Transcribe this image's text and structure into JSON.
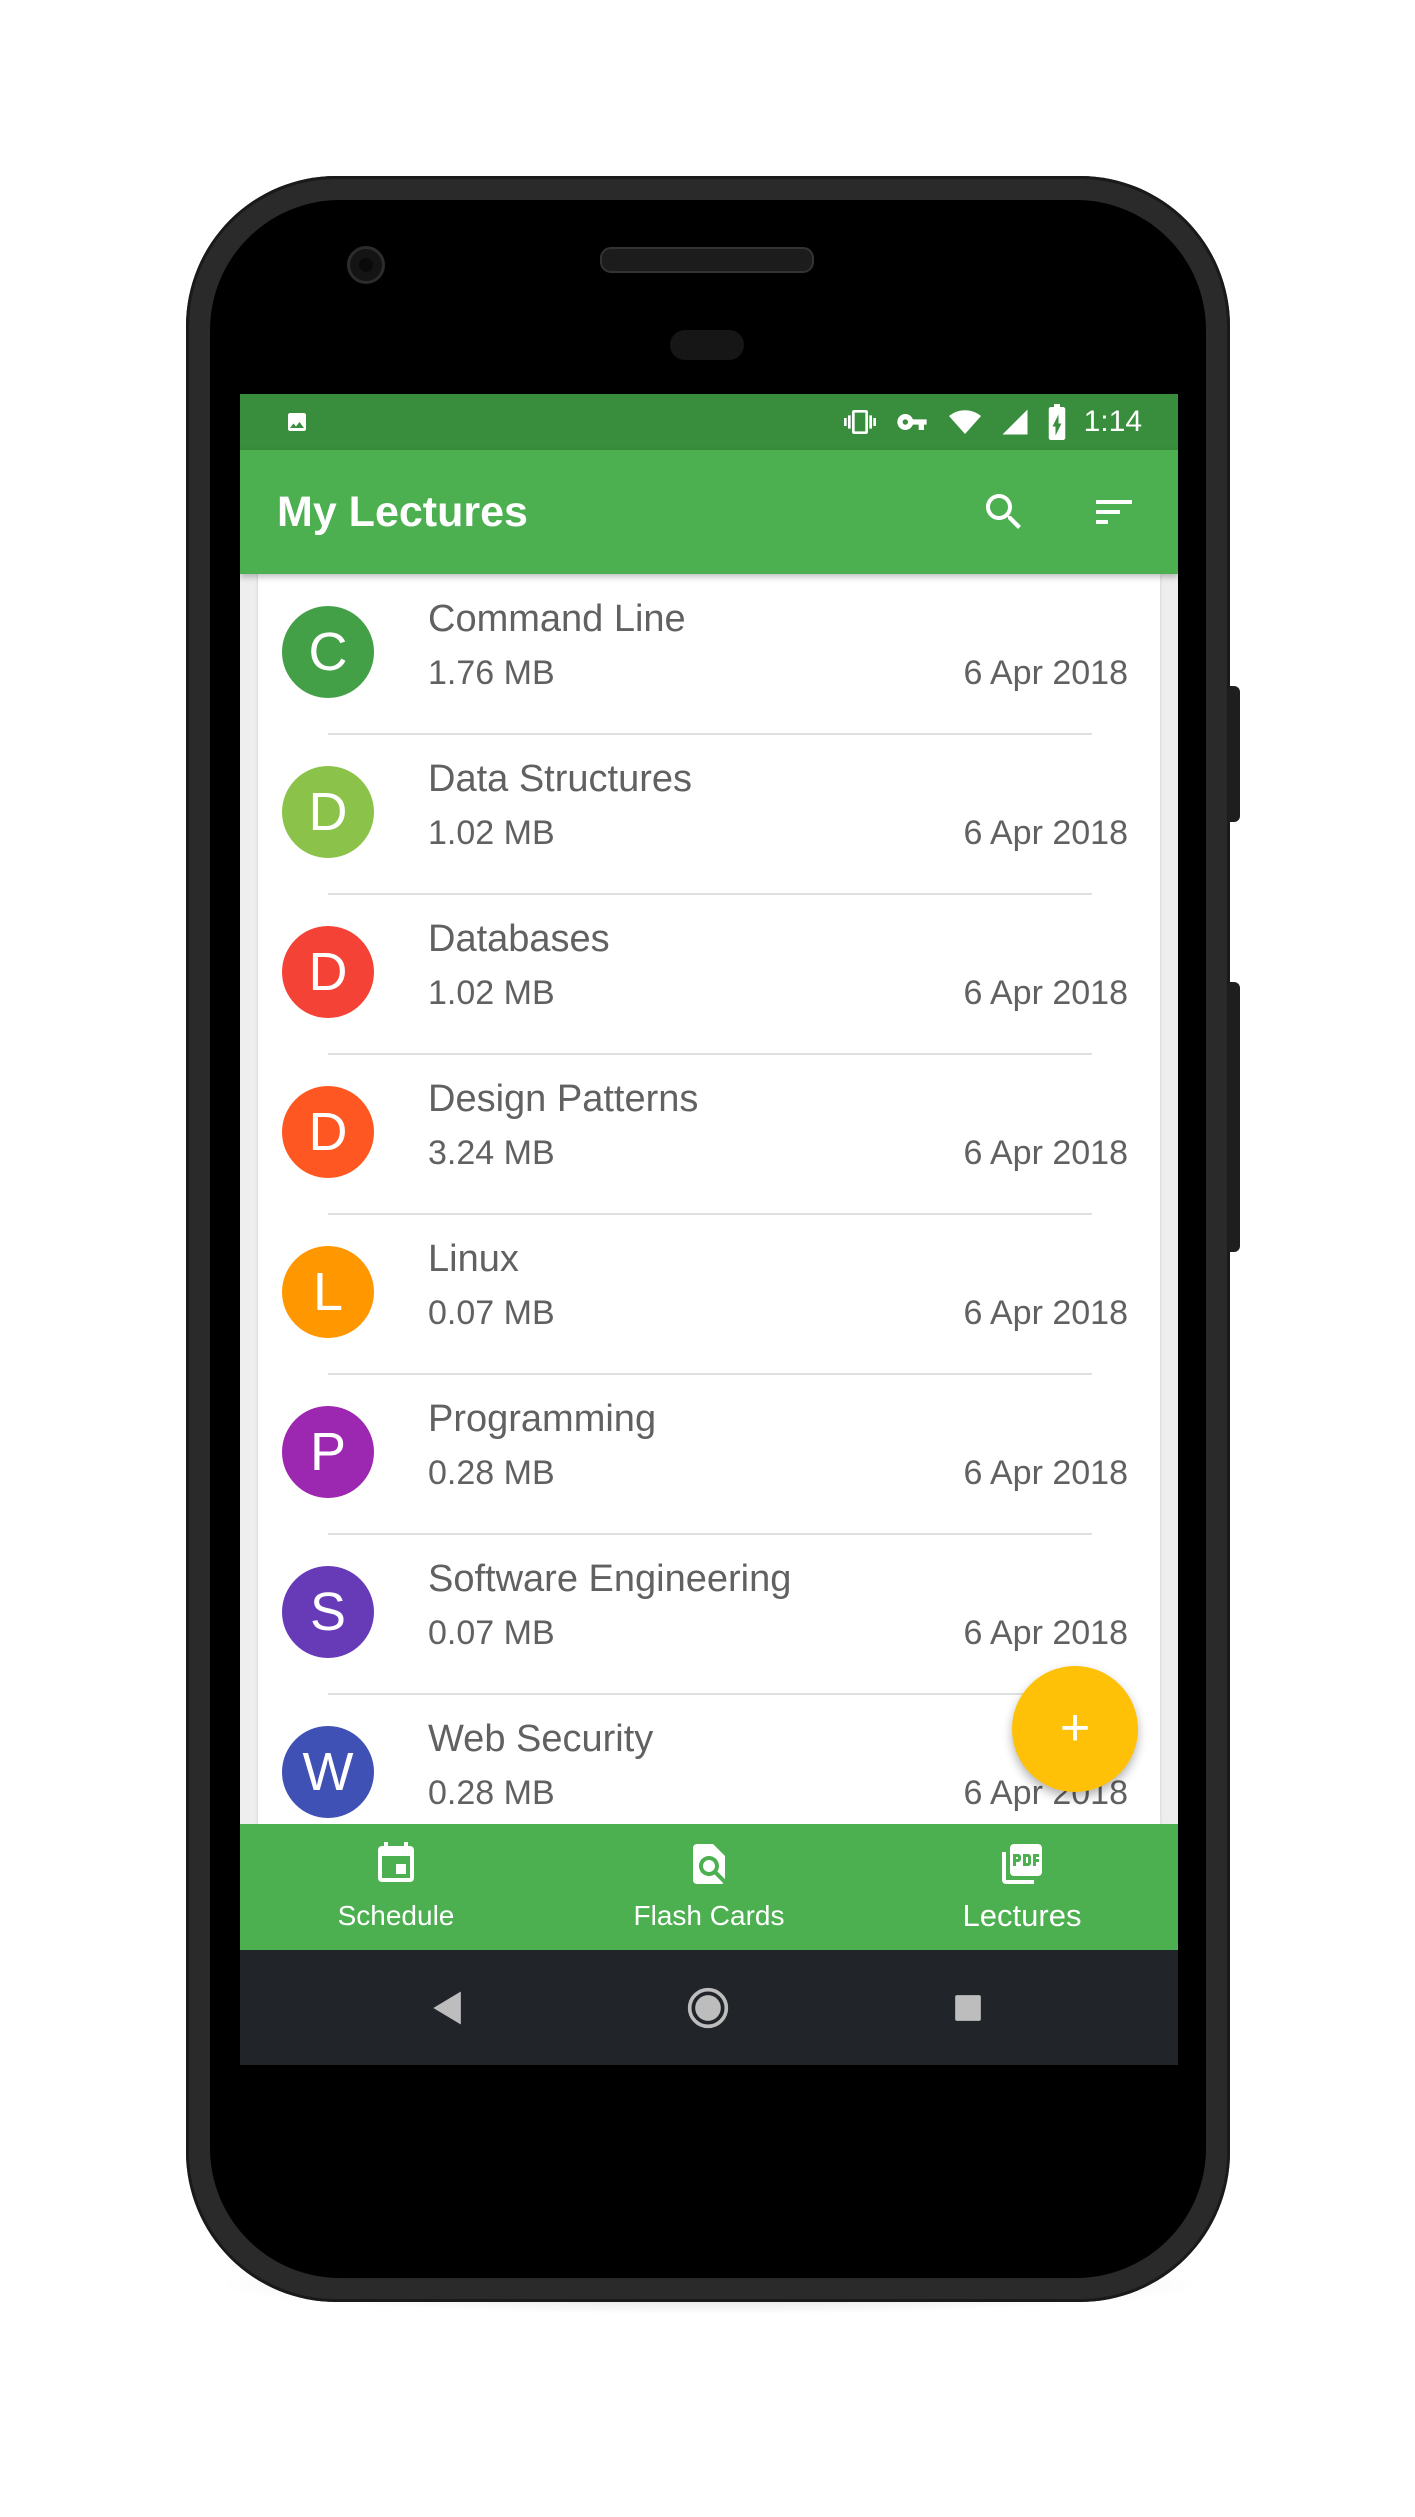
{
  "status_bar": {
    "time": "1:14",
    "icons": [
      "image-icon",
      "vibrate-icon",
      "vpn-key-icon",
      "wifi-icon",
      "signal-icon",
      "battery-charging-icon"
    ]
  },
  "app_bar": {
    "title": "My Lectures",
    "icons": [
      "search-icon",
      "sort-icon"
    ]
  },
  "lectures": [
    {
      "initial": "C",
      "title": "Command Line",
      "size": "1.76 MB",
      "date": "6 Apr 2018",
      "color": "#43a047"
    },
    {
      "initial": "D",
      "title": "Data Structures",
      "size": "1.02 MB",
      "date": "6 Apr 2018",
      "color": "#8bc34a"
    },
    {
      "initial": "D",
      "title": "Databases",
      "size": "1.02 MB",
      "date": "6 Apr 2018",
      "color": "#f44336"
    },
    {
      "initial": "D",
      "title": "Design Patterns",
      "size": "3.24 MB",
      "date": "6 Apr 2018",
      "color": "#ff5722"
    },
    {
      "initial": "L",
      "title": "Linux",
      "size": "0.07 MB",
      "date": "6 Apr 2018",
      "color": "#ff9800"
    },
    {
      "initial": "P",
      "title": "Programming",
      "size": "0.28 MB",
      "date": "6 Apr 2018",
      "color": "#9c27b0"
    },
    {
      "initial": "S",
      "title": "Software Engineering",
      "size": "0.07 MB",
      "date": "6 Apr 2018",
      "color": "#673ab7"
    },
    {
      "initial": "W",
      "title": "Web Security",
      "size": "0.28 MB",
      "date": "6 Apr 2018",
      "color": "#3f51b5"
    }
  ],
  "fab": {
    "label": "+",
    "color": "#ffc107"
  },
  "bottom_nav": {
    "items": [
      {
        "label": "Schedule",
        "icon": "calendar-icon",
        "active": false
      },
      {
        "label": "Flash Cards",
        "icon": "flash-card-search-icon",
        "active": false
      },
      {
        "label": "Lectures",
        "icon": "pdf-icon",
        "active": true
      }
    ]
  },
  "system_nav": {
    "icons": [
      "back-icon",
      "home-icon",
      "recents-icon"
    ]
  },
  "colors": {
    "primary": "#4caf50",
    "primary_dark": "#388e3c",
    "accent": "#ffc107",
    "text": "#616161"
  }
}
